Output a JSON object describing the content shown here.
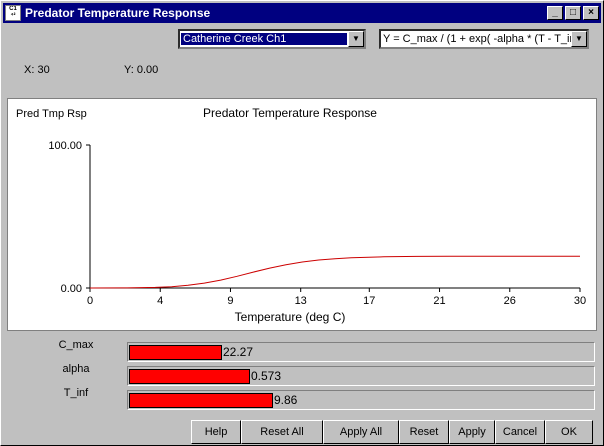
{
  "window": {
    "title": "Predator Temperature Response",
    "icon_text": "C1 ⁴²",
    "controls": [
      "minimize-icon",
      "maximize-icon",
      "close-icon"
    ]
  },
  "selectors": {
    "dataset": "Catherine Creek Ch1",
    "equation": "Y = C_max / (1 + exp( -alpha * (T - T_inf"
  },
  "coords": {
    "x": "X: 30",
    "y": "Y: 0.00"
  },
  "chart_data": {
    "type": "line",
    "ylabel_topleft": "Pred Tmp Rsp",
    "title": "Predator Temperature Response",
    "xlabel": "Temperature (deg C)",
    "xlim": [
      0,
      30
    ],
    "ylim": [
      0,
      100
    ],
    "yticks": [
      "100.00",
      "0.00"
    ],
    "xticks": [
      "0",
      "4",
      "9",
      "13",
      "17",
      "21",
      "26",
      "30"
    ],
    "xtick_values": [
      0,
      4.3,
      8.6,
      12.9,
      17.1,
      21.4,
      25.7,
      30
    ],
    "series_color": "#cc0000",
    "x": [
      0,
      2,
      4,
      5,
      6,
      7,
      8,
      9,
      10,
      11,
      12,
      13,
      14,
      15,
      16,
      18,
      20,
      22,
      25,
      28,
      30
    ],
    "y": [
      0.0,
      0.1,
      0.4,
      0.9,
      1.9,
      3.4,
      5.5,
      8.2,
      11.1,
      13.9,
      16.3,
      18.2,
      19.6,
      20.5,
      21.2,
      21.8,
      22.1,
      22.2,
      22.27,
      22.27,
      22.27
    ]
  },
  "parameters": [
    {
      "label": "C_max",
      "value": "22.27",
      "fill_fraction": 0.2
    },
    {
      "label": "alpha",
      "value": "0.573",
      "fill_fraction": 0.26
    },
    {
      "label": "T_inf",
      "value": "9.86",
      "fill_fraction": 0.31
    }
  ],
  "buttons": {
    "help": "Help",
    "reset_all": "Reset All",
    "apply_all": "Apply All",
    "reset": "Reset",
    "apply": "Apply",
    "cancel": "Cancel",
    "ok": "OK"
  }
}
